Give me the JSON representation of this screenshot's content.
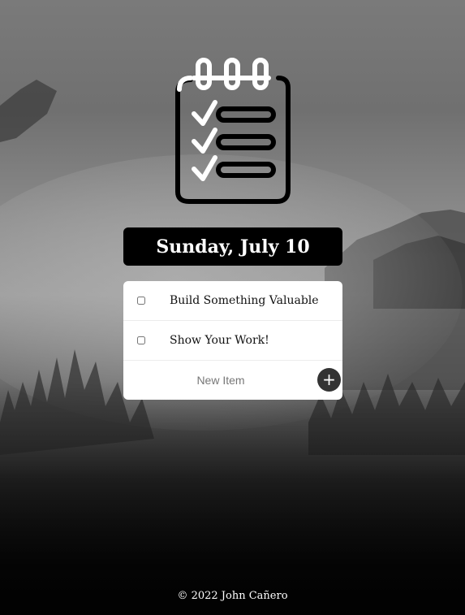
{
  "header": {
    "date": "Sunday, July 10"
  },
  "todo": {
    "items": [
      {
        "label": "Build Something Valuable",
        "checked": false
      },
      {
        "label": "Show Your Work!",
        "checked": false
      }
    ],
    "new_item_placeholder": "New Item",
    "new_item_value": "",
    "add_label": "+"
  },
  "footer": {
    "text": "© 2022 John Cañero"
  },
  "colors": {
    "banner": "#000000",
    "card": "#ffffff",
    "add_button": "#333333",
    "footer_text": "#ffffff"
  },
  "icons": {
    "logo": "checklist-notepad-icon",
    "add": "plus-icon"
  }
}
